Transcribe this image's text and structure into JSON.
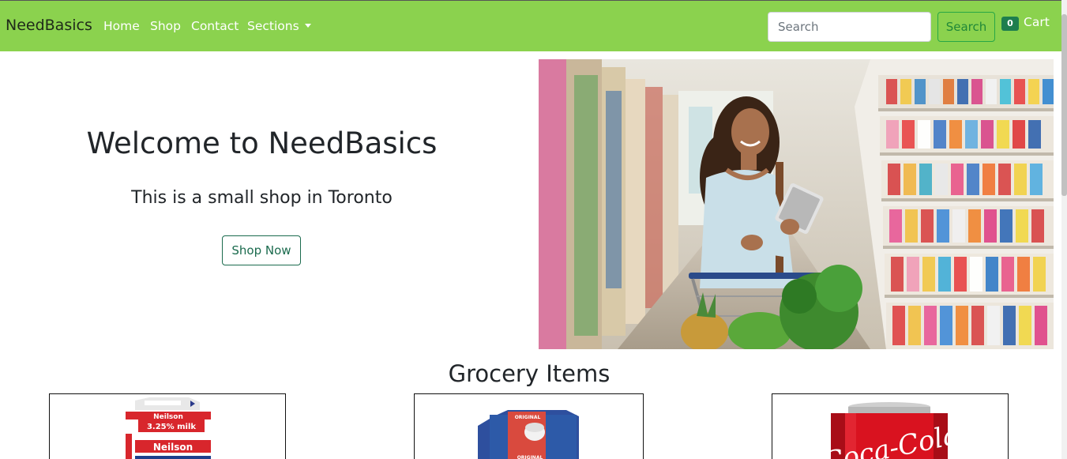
{
  "navbar": {
    "brand": "NeedBasics",
    "links": [
      "Home",
      "Shop",
      "Contact",
      "Sections"
    ],
    "search_placeholder": "Search",
    "search_button": "Search",
    "cart_count": "0",
    "cart_label": "Cart",
    "background": "#8bd24e"
  },
  "hero": {
    "title": "Welcome to NeedBasics",
    "subtitle": "This is a small shop in Toronto",
    "button": "Shop Now"
  },
  "section": {
    "title": "Grocery Items"
  },
  "products": [
    {
      "image": "milk-carton-image",
      "logo_text": "Neilson",
      "label_text": "3.25% milk"
    },
    {
      "image": "blue-carton-image",
      "logo_text": "ORIGINAL"
    },
    {
      "image": "coca-cola-can-image",
      "logo_text": "Coca-Cola"
    }
  ]
}
